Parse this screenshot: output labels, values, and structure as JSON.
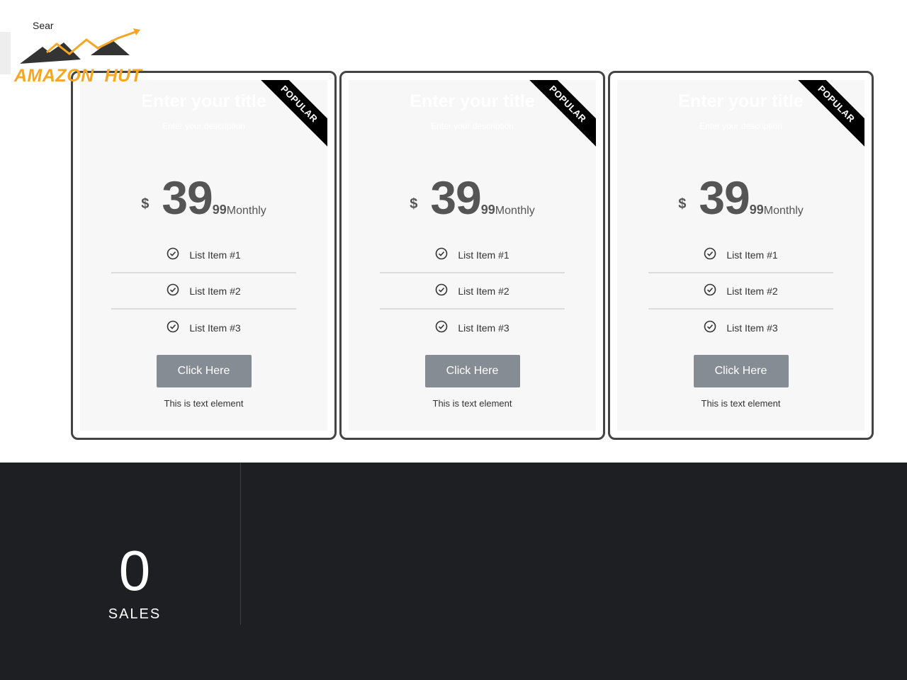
{
  "header": {
    "search_label": "Sear",
    "logo_text": "AMAZON  HUT",
    "colors": {
      "logo_orange": "#f5a623",
      "logo_dark": "#333333"
    }
  },
  "pricing": {
    "cards": [
      {
        "ribbon": "POPULAR",
        "title": "Enter your title",
        "description": "Enter your description",
        "currency": "$",
        "amount": "39",
        "cents": "99",
        "period": "Monthly",
        "items": [
          "List Item #1",
          "List Item #2",
          "List Item #3"
        ],
        "button": "Click Here",
        "footer": "This is text element"
      },
      {
        "ribbon": "POPULAR",
        "title": "Enter your title",
        "description": "Enter your description",
        "currency": "$",
        "amount": "39",
        "cents": "99",
        "period": "Monthly",
        "items": [
          "List Item #1",
          "List Item #2",
          "List Item #3"
        ],
        "button": "Click Here",
        "footer": "This is text element"
      },
      {
        "ribbon": "POPULAR",
        "title": "Enter your title",
        "description": "Enter your description",
        "currency": "$",
        "amount": "39",
        "cents": "99",
        "period": "Monthly",
        "items": [
          "List Item #1",
          "List Item #2",
          "List Item #3"
        ],
        "button": "Click Here",
        "footer": "This is text element"
      }
    ],
    "icons": {
      "list_item": "check-circle-icon"
    },
    "colors": {
      "button": "#868c94",
      "card_bg": "#f7f7f7",
      "ribbon": "#000000"
    }
  },
  "stats": {
    "counter_value": "0",
    "counter_label": "SALES",
    "colors": {
      "background": "#1e1f23"
    }
  }
}
